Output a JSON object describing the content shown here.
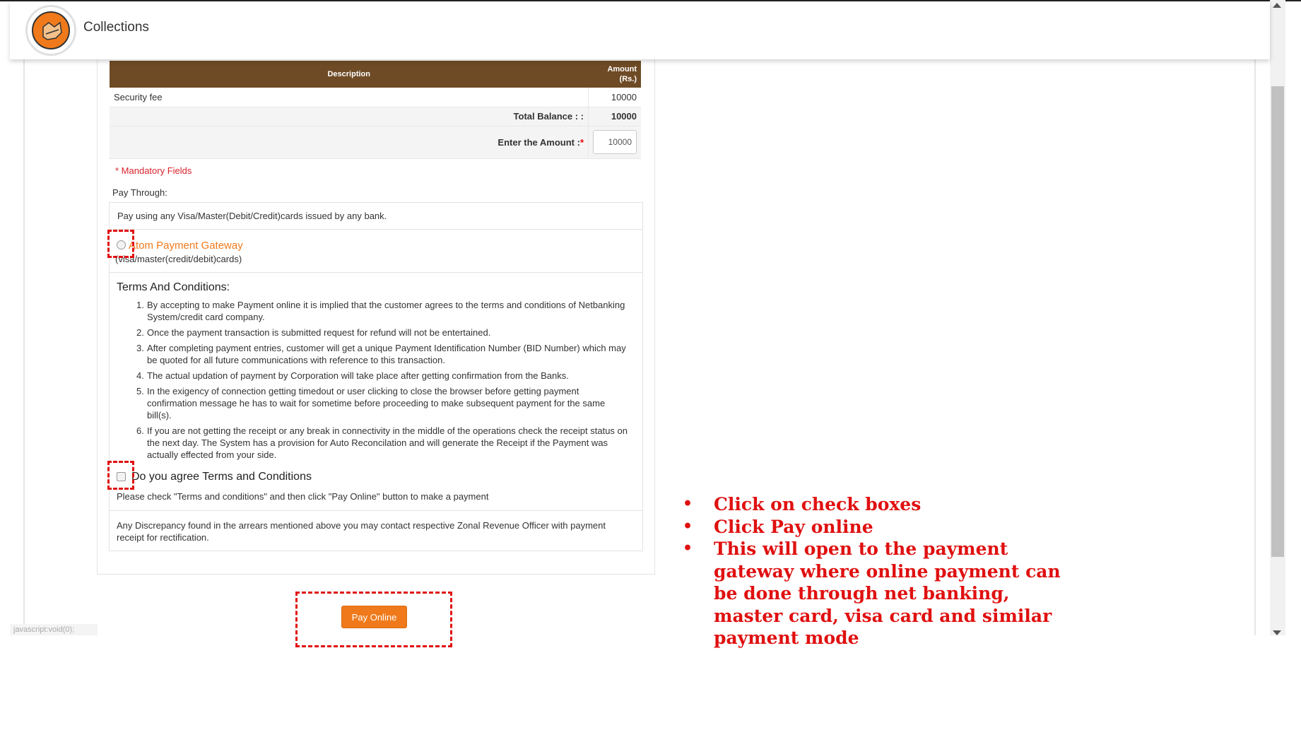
{
  "header": {
    "title": "Collections",
    "logo_icon": "corporation-logo-icon"
  },
  "table": {
    "col_description": "Description",
    "col_amount_line1": "Amount",
    "col_amount_line2": "(Rs.)",
    "rows": [
      {
        "description": "Security fee",
        "amount": "10000"
      }
    ],
    "total_label": "Total Balance : :",
    "total_value": "10000",
    "enter_amount_label": "Enter the Amount :",
    "enter_amount_required": "*",
    "enter_amount_value": "10000"
  },
  "form": {
    "mandatory_note": "* Mandatory Fields",
    "pay_through_label": "Pay Through:",
    "pay_using_text": "Pay using any Visa/Master(Debit/Credit)cards issued by any bank.",
    "gateway_label": "Atom Payment Gateway",
    "gateway_sub": "(visa/master(credit/debit)cards)",
    "terms_title": "Terms And Conditions:",
    "terms": [
      {
        "num": "1.",
        "text": "By accepting to make Payment online it is implied that the customer agrees to the terms and conditions of Netbanking System/credit card company."
      },
      {
        "num": "2.",
        "text": "Once the payment transaction is submitted request for refund will not be entertained."
      },
      {
        "num": "3.",
        "text": "After completing payment entries, customer will get a unique Payment Identification Number (BID Number) which may be quoted for all future communications with reference to this transaction."
      },
      {
        "num": "4.",
        "text": "The actual updation of payment by Corporation will take place after getting confirmation from the Banks."
      },
      {
        "num": "5.",
        "text": "In the exigency of connection getting timedout or user clicking to close the browser before getting payment confirmation message he has to wait for sometime before proceeding to make subsequent payment for the same bill(s)."
      },
      {
        "num": "6.",
        "text": "If you are not getting the receipt or any break in connectivity in the middle of the operations check the receipt status on the next day. The System has a provision for Auto Reconcilation and will generate the Receipt if the Payment was actually effected from your side."
      }
    ],
    "agree_label": "Do you agree Terms and Conditions",
    "check_note": "Please check \"Terms and conditions\" and then click \"Pay Online\" button to make a payment",
    "discrepancy_note": "Any Discrepancy found in the arrears mentioned above you may contact respective Zonal Revenue Officer with payment receipt for rectification.",
    "pay_button_label": "Pay Online"
  },
  "status_bar": {
    "url": "javascript:void(0);"
  },
  "annotation": {
    "bullet_char": "•",
    "items": [
      "Click on check boxes",
      "Click Pay online",
      "This will open to the payment gateway where online payment can be done through net banking, master card, visa card and similar payment mode"
    ]
  },
  "colors": {
    "table_header": "#6e4b25",
    "accent_orange": "#f07a1b",
    "annotation_red": "#e01010",
    "mandatory_red": "#d9232d"
  }
}
